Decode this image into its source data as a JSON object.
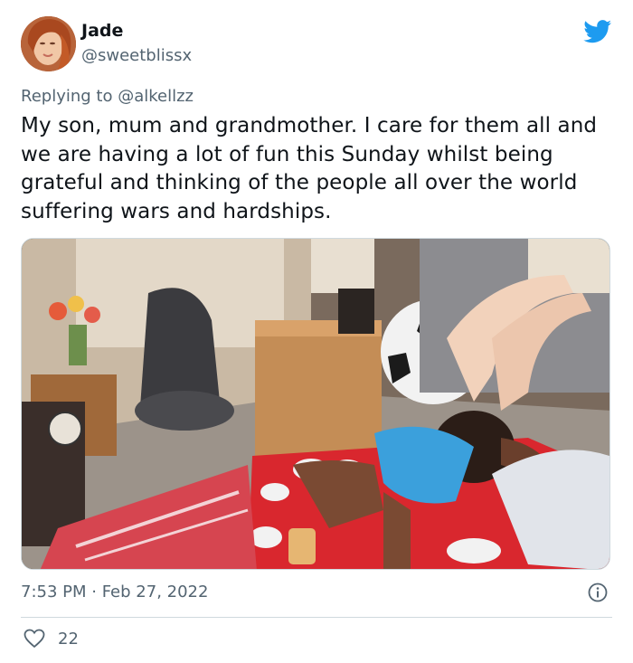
{
  "author": {
    "display_name": "Jade",
    "handle": "@sweetblissx",
    "avatar_icon": "profile-photo"
  },
  "reply": {
    "prefix": "Replying to",
    "mention": "@alkellzz"
  },
  "tweet": {
    "text": "My son, mum and grandmother. I care for them all and we are having a lot of fun this Sunday whilst being grateful and thinking of the people all over the world suffering wars and hardships.",
    "timestamp": "7:53 PM · Feb 27, 2022"
  },
  "engagement": {
    "likes": "22"
  },
  "colors": {
    "twitter_blue": "#1d9bf0",
    "secondary_text": "#536471",
    "divider": "#cfd9de"
  },
  "icons": [
    "twitter-bird-icon",
    "info-icon",
    "heart-icon"
  ]
}
